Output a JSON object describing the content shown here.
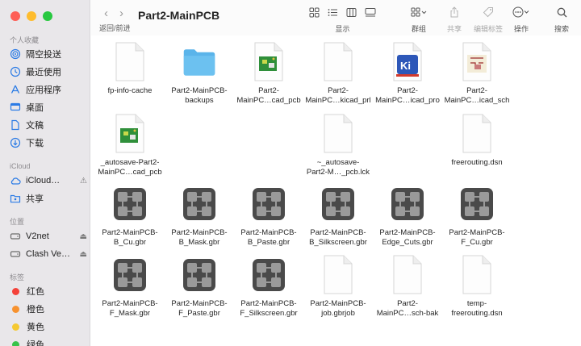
{
  "window": {
    "title": "Part2-MainPCB",
    "nav_label": "返回/前进"
  },
  "toolbar": {
    "view_label": "显示",
    "group_label": "群组",
    "share_label": "共享",
    "tags_label": "编辑标签",
    "action_label": "操作",
    "search_label": "搜索"
  },
  "sidebar": {
    "favorites_title": "个人收藏",
    "favorites": [
      {
        "label": "隔空投送",
        "icon": "airdrop-icon"
      },
      {
        "label": "最近使用",
        "icon": "clock-icon"
      },
      {
        "label": "应用程序",
        "icon": "applications-icon"
      },
      {
        "label": "桌面",
        "icon": "desktop-icon"
      },
      {
        "label": "文稿",
        "icon": "document-icon"
      },
      {
        "label": "下载",
        "icon": "download-icon"
      }
    ],
    "icloud_title": "iCloud",
    "icloud": [
      {
        "label": "iCloud…",
        "icon": "cloud-icon"
      },
      {
        "label": "共享",
        "icon": "shared-folder-icon"
      }
    ],
    "locations_title": "位置",
    "locations": [
      {
        "label": "V2net",
        "icon": "disk-icon"
      },
      {
        "label": "Clash Ve…",
        "icon": "disk-icon"
      }
    ],
    "tags_title": "标签",
    "tags": [
      {
        "label": "红色",
        "color": "#f4423a"
      },
      {
        "label": "橙色",
        "color": "#f7922f"
      },
      {
        "label": "黄色",
        "color": "#f5c932"
      },
      {
        "label": "绿色",
        "color": "#38c34a"
      }
    ]
  },
  "files": [
    {
      "name": "fp-info-cache",
      "kind": "blank"
    },
    {
      "name": "Part2-MainPCB-\nbackups",
      "kind": "folder"
    },
    {
      "name": "Part2-\nMainPC…cad_pcb",
      "kind": "kicad-pcb"
    },
    {
      "name": "Part2-\nMainPC…kicad_prl",
      "kind": "blank"
    },
    {
      "name": "Part2-\nMainPC…icad_pro",
      "kind": "kicad-pro"
    },
    {
      "name": "Part2-\nMainPC…icad_sch",
      "kind": "kicad-sch"
    },
    {
      "name": "_autosave-Part2-\nMainPC…cad_pcb",
      "kind": "kicad-pcb"
    },
    {
      "name": "~_autosave-\nPart2-M…_pcb.lck",
      "kind": "blank"
    },
    {
      "name": "freerouting.dsn",
      "kind": "blank"
    },
    {
      "name": "Part2-MainPCB-\nB_Cu.gbr",
      "kind": "gerber"
    },
    {
      "name": "Part2-MainPCB-\nB_Mask.gbr",
      "kind": "gerber"
    },
    {
      "name": "Part2-MainPCB-\nB_Paste.gbr",
      "kind": "gerber"
    },
    {
      "name": "Part2-MainPCB-\nB_Silkscreen.gbr",
      "kind": "gerber"
    },
    {
      "name": "Part2-MainPCB-\nEdge_Cuts.gbr",
      "kind": "gerber"
    },
    {
      "name": "Part2-MainPCB-\nF_Cu.gbr",
      "kind": "gerber"
    },
    {
      "name": "Part2-MainPCB-\nF_Mask.gbr",
      "kind": "gerber"
    },
    {
      "name": "Part2-MainPCB-\nF_Paste.gbr",
      "kind": "gerber"
    },
    {
      "name": "Part2-MainPCB-\nF_Silkscreen.gbr",
      "kind": "gerber"
    },
    {
      "name": "Part2-MainPCB-\njob.gbrjob",
      "kind": "blank"
    },
    {
      "name": "Part2-\nMainPC…sch-bak",
      "kind": "blank"
    },
    {
      "name": "temp-\nfreerouting.dsn",
      "kind": "blank"
    }
  ],
  "colors": {
    "folder": "#5ab4ea",
    "gerber": "#4a4a4a",
    "kicad_blue": "#2d57b8"
  }
}
